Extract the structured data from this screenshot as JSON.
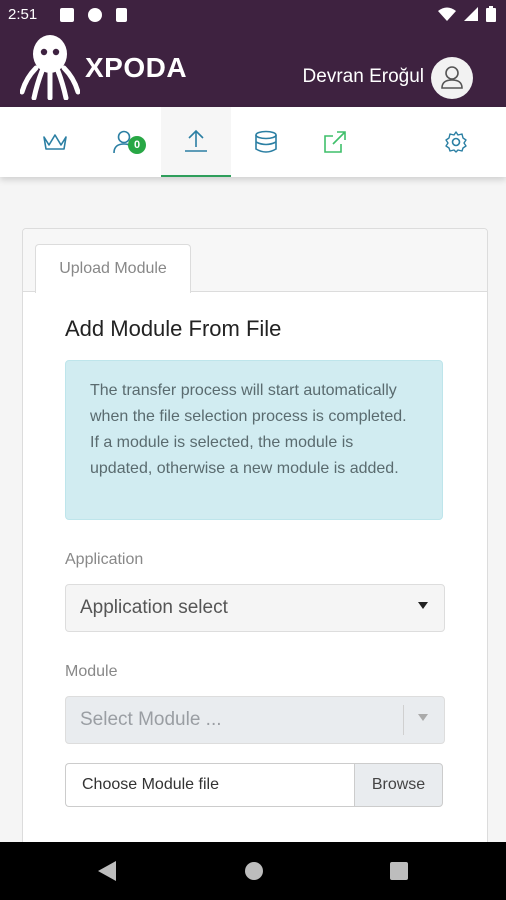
{
  "status_bar": {
    "time": "2:51"
  },
  "header": {
    "brand": "XPODA",
    "user_name": "Devran Eroğul"
  },
  "nav": {
    "items": [
      {
        "name": "crown",
        "icon": "crown-icon"
      },
      {
        "name": "users",
        "icon": "user-icon",
        "badge": "0"
      },
      {
        "name": "upload",
        "icon": "upload-icon",
        "active": true
      },
      {
        "name": "database",
        "icon": "database-icon"
      },
      {
        "name": "external",
        "icon": "external-link-icon"
      },
      {
        "name": "settings",
        "icon": "gear-icon"
      }
    ]
  },
  "card": {
    "tab_label": "Upload Module",
    "title": "Add Module From File",
    "alert_lines": [
      "The transfer process will start automatically when the file selection process is completed.",
      "If a module is selected, the module is updated, otherwise a new module is added."
    ],
    "application": {
      "label": "Application",
      "value": "Application select"
    },
    "module": {
      "label": "Module",
      "placeholder": "Select Module ..."
    },
    "file": {
      "placeholder": "Choose Module file",
      "browse_label": "Browse"
    }
  },
  "colors": {
    "brand": "#3e2240",
    "accent": "#2e9e5b",
    "info_bg": "#d1ecf1"
  }
}
